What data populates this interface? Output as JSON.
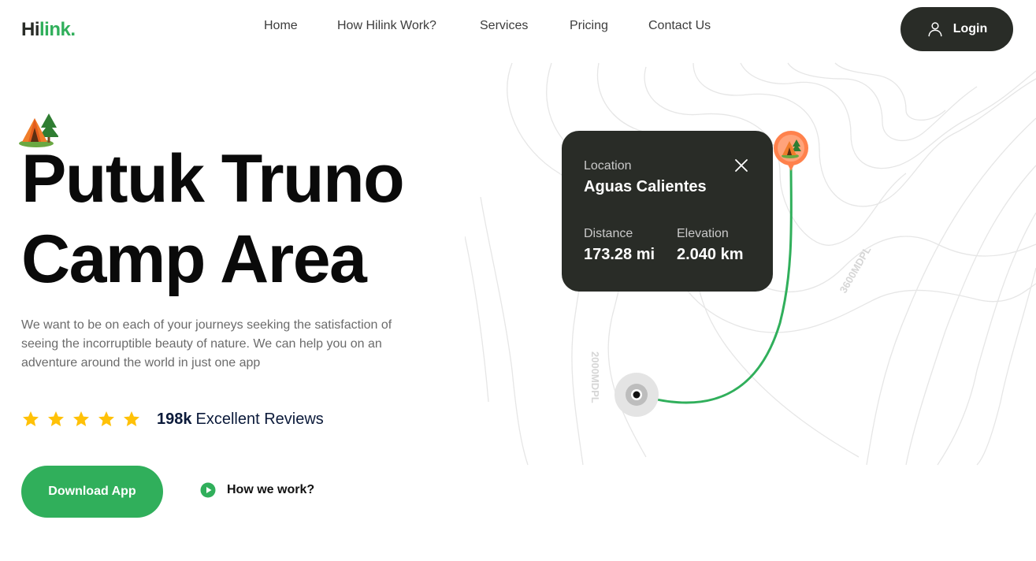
{
  "nav": {
    "logo_part1": "Hi",
    "logo_part2": "link.",
    "items": [
      {
        "label": "Home"
      },
      {
        "label": "How Hilink Work?"
      },
      {
        "label": "Services"
      },
      {
        "label": "Pricing"
      },
      {
        "label": "Contact Us"
      }
    ],
    "login_label": "Login",
    "login_icon": "user-icon"
  },
  "hero": {
    "icon": "tent-camp-icon",
    "title_line1": "Putuk Truno",
    "title_line2": "Camp Area",
    "description": "We want to be on each of your journeys seeking the satisfaction of seeing the incorruptible beauty of nature. We can help you on an adventure around the world in just one app",
    "rating": {
      "stars": 5,
      "count": "198k",
      "label": "Excellent Reviews"
    },
    "download_label": "Download App",
    "how_label": "How we work?",
    "how_icon": "play-circle-icon"
  },
  "map": {
    "contour_labels": [
      "2000MDPL",
      "3600MDPL"
    ],
    "card": {
      "location_label": "Location",
      "location_value": "Aguas Calientes",
      "distance_label": "Distance",
      "distance_value": "173.28 mi",
      "elevation_label": "Elevation",
      "elevation_value": "2.040 km"
    }
  },
  "colors": {
    "brand_green": "#30af5b",
    "dark": "#292c27",
    "star_yellow": "#ffc107",
    "pin_orange": "#ff814c"
  }
}
